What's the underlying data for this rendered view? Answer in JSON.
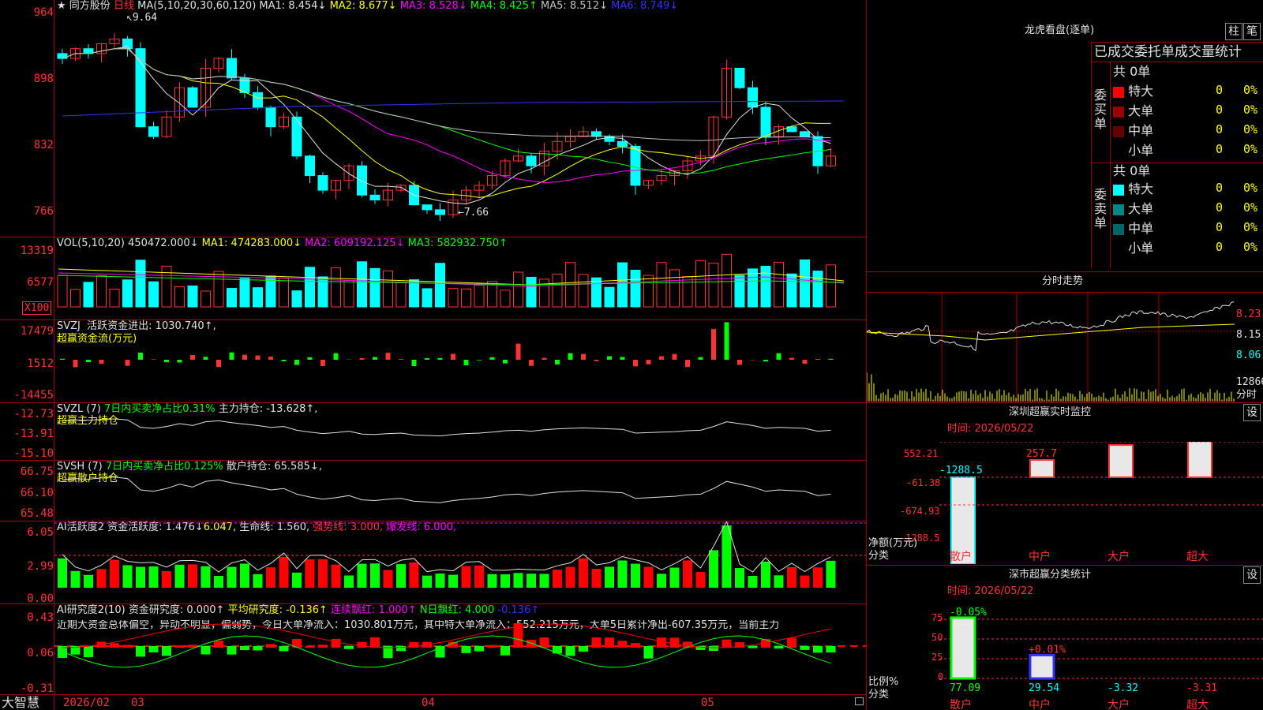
{
  "header": {
    "stock_name": "同方股份",
    "period": "日线",
    "ma_label": "MA(5,10,20,30,60,120)",
    "ma": [
      {
        "label": "MA1:",
        "value": "8.454↓",
        "color": "#e0e0e0"
      },
      {
        "label": "MA2:",
        "value": "8.677↓",
        "color": "#ffff00"
      },
      {
        "label": "MA3:",
        "value": "8.528↓",
        "color": "#ff00ff"
      },
      {
        "label": "MA4:",
        "value": "8.425↑",
        "color": "#00ff00"
      },
      {
        "label": "MA5:",
        "value": "8.512↓",
        "color": "#c0c0c0"
      },
      {
        "label": "MA6:",
        "value": "8.749↓",
        "color": "#3333ff"
      }
    ]
  },
  "price_axis": {
    "ticks": [
      "964",
      "898",
      "832",
      "766"
    ],
    "high_mark": "9.64",
    "low_mark": "7.66"
  },
  "vol": {
    "label": "VOL(5,10,20)",
    "value": "450472.000↓",
    "ma1": "MA1: 474283.000↓",
    "ma2": "MA2: 609192.125↓",
    "ma3": "MA3: 582932.750↑",
    "ticks": [
      "13319",
      "6577"
    ],
    "unit": "X100"
  },
  "svzj": {
    "label": "SVZJ",
    "line1": "活跃资金进出: 1030.740↑,",
    "line2": "超赢资金流(万元)",
    "ticks": [
      "17479",
      "1512",
      "-14455"
    ]
  },
  "svzl": {
    "label": "SVZL (7)",
    "pct": "7日内买卖净占比0.31%",
    "hold": "主力持仓: -13.628↑,",
    "line2": "超赢主力持仓",
    "ticks": [
      "-12.73",
      "-13.91",
      "-15.10"
    ]
  },
  "svsh": {
    "label": "SVSH (7)",
    "pct": "7日内买卖净占比0.125%",
    "hold": "散户持仓: 65.585↓,",
    "line2": "超赢散户持仓",
    "ticks": [
      "66.75",
      "66.10",
      "65.48"
    ]
  },
  "ai_active": {
    "label": "AI活跃度2",
    "a": "资金活跃度: 1.476↓",
    "b": "6.047,",
    "c": "生命线: 1.560,",
    "d": "强势线: 3.000,",
    "e": "爆发线: 6.000,",
    "ticks": [
      "6.05",
      "2.99",
      "0.00"
    ]
  },
  "ai_research": {
    "label": "AI研究度2(10)",
    "a": "资金研究度: 0.000↑",
    "b": "平均研究度: -0.136↑",
    "c": "连续飘红: 1.000↑",
    "d": "N日飘红: 4.000",
    "e": "-0.136↑",
    "summary": "近期大资金总体偏空，异动不明显，偏弱势，今日大单净流入：1030.801万元，其中特大单净流入：552.215万元，大单5日累计净出-607.35万元，当前主力",
    "ticks": [
      "0.43",
      "0.06",
      "-0.31"
    ]
  },
  "date_axis": {
    "brand": "大智慧",
    "labels": [
      "2026/02",
      "03",
      "04",
      "05"
    ]
  },
  "dragon": {
    "title": "龙虎看盘(逐单)",
    "btn1": "柱",
    "btn2": "笔",
    "header": "已成交委托单成交量统计",
    "buy_label": "委买单",
    "sell_label": "委卖单",
    "buy_total": "共 0单",
    "sell_total": "共 0单",
    "buy_rows": [
      {
        "name": "特大",
        "color": "#ff0000",
        "v": "0",
        "p": "0%"
      },
      {
        "name": "大单",
        "color": "#990000",
        "v": "0",
        "p": "0%"
      },
      {
        "name": "中单",
        "color": "#660000",
        "v": "0",
        "p": "0%"
      },
      {
        "name": "小单",
        "color": "#000000",
        "v": "0",
        "p": "0%"
      }
    ],
    "sell_rows": [
      {
        "name": "特大",
        "color": "#00ffff",
        "v": "0",
        "p": "0%"
      },
      {
        "name": "大单",
        "color": "#008888",
        "v": "0",
        "p": "0%"
      },
      {
        "name": "中单",
        "color": "#006666",
        "v": "0",
        "p": "0%"
      },
      {
        "name": "小单",
        "color": "#000000",
        "v": "0",
        "p": "0%"
      }
    ]
  },
  "intraday": {
    "title": "分时走势",
    "ticks": [
      "8.23",
      "8.15",
      "8.06"
    ],
    "vol_tick": "12866",
    "vol_unit": "分时"
  },
  "monitor": {
    "title": "深圳超赢实时监控",
    "btn": "设",
    "time": "时间: 2026/05/22",
    "ticks": [
      "552.21",
      "-61.38",
      "-674.93",
      "-1288.5"
    ],
    "ylabel": "净额(万元)",
    "xlabel": "分类",
    "chart_data": {
      "type": "bar",
      "categories": [
        "散户",
        "中户",
        "大户",
        "超大"
      ],
      "values": [
        -1288.5,
        257.7,
        478.59,
        552.21
      ],
      "labels": [
        "-1288.5",
        "257.7",
        "478.59",
        "552.21"
      ]
    }
  },
  "classify": {
    "title": "深市超赢分类统计",
    "btn": "设",
    "time": "时间: 2026/05/22",
    "ticks": [
      "75",
      "50",
      "25",
      "0"
    ],
    "ylabel": "比例%",
    "xlabel": "分类",
    "chart_data": {
      "type": "bar",
      "categories": [
        "散户",
        "中户",
        "大户",
        "超大"
      ],
      "values": [
        77.09,
        29.54,
        -3.32,
        -3.31
      ],
      "top_labels": [
        "-0.05%",
        "+0.01%",
        "",
        ""
      ],
      "bottom_labels": [
        "77.09",
        "29.54",
        "-3.32",
        "-3.31"
      ]
    }
  }
}
